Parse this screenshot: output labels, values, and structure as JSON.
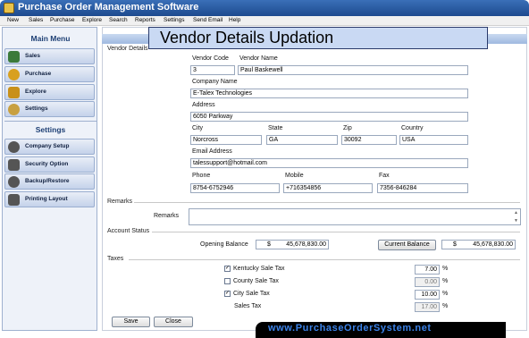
{
  "app": {
    "title": "Purchase Order Management Software"
  },
  "menu": [
    "New",
    "Sales",
    "Purchase",
    "Explore",
    "Search",
    "Reports",
    "Settings",
    "Send Email",
    "Help"
  ],
  "sidebar": {
    "main_title": "Main Menu",
    "main_items": [
      {
        "label": "Sales",
        "icon": "sales-icon",
        "color": "#3b7a3a"
      },
      {
        "label": "Purchase",
        "icon": "purchase-icon",
        "color": "#d8a020"
      },
      {
        "label": "Explore",
        "icon": "explore-icon",
        "color": "#c8901a"
      },
      {
        "label": "Settings",
        "icon": "settings-icon",
        "color": "#c8a040"
      }
    ],
    "settings_title": "Settings",
    "settings_items": [
      {
        "label": "Company Setup",
        "icon": "company-setup-icon",
        "color": "#555555"
      },
      {
        "label": "Security Option",
        "icon": "security-option-icon",
        "color": "#555555"
      },
      {
        "label": "Backup/Restore",
        "icon": "backup-restore-icon",
        "color": "#555555"
      },
      {
        "label": "Printing Layout",
        "icon": "printing-layout-icon",
        "color": "#555555"
      }
    ]
  },
  "banner": "Vendor Details Updation",
  "vendor": {
    "group": "Vendor Details",
    "code_label": "Vendor Code",
    "code": "3",
    "name_label": "Vendor Name",
    "name": "Paul Baskewell",
    "company_label": "Company Name",
    "company": "E-Talex Technologies",
    "address_label": "Address",
    "address": "6050 Parkway",
    "city_label": "City",
    "city": "Norcross",
    "state_label": "State",
    "state": "GA",
    "zip_label": "Zip",
    "zip": "30092",
    "country_label": "Country",
    "country": "USA",
    "email_label": "Email Address",
    "email": "talessupport@hotmail.com",
    "phone_label": "Phone",
    "phone": "8754-6752946",
    "mobile_label": "Mobile",
    "mobile": "+716354856",
    "fax_label": "Fax",
    "fax": "7356-846284"
  },
  "remarks": {
    "group": "Remarks",
    "label": "Remarks",
    "value": ""
  },
  "account": {
    "group": "Account Status",
    "opening_label": "Opening Balance",
    "opening_currency": "$",
    "opening_value": "45,678,830.00",
    "current_button": "Current Balance",
    "current_currency": "$",
    "current_value": "45,678,830.00"
  },
  "taxes": {
    "group": "Taxes",
    "items": [
      {
        "label": "Kentucky Sale Tax",
        "checked": true,
        "value": "7.00",
        "unit": "%"
      },
      {
        "label": "County Sale Tax",
        "checked": false,
        "value": "0.00",
        "unit": "%"
      },
      {
        "label": "City Sale Tax",
        "checked": true,
        "value": "10.00",
        "unit": "%"
      }
    ],
    "sales_tax_label": "Sales Tax",
    "sales_tax_value": "17.00",
    "sales_tax_unit": "%"
  },
  "buttons": {
    "save": "Save",
    "close": "Close"
  },
  "footer": "www.PurchaseOrderSystem.net"
}
